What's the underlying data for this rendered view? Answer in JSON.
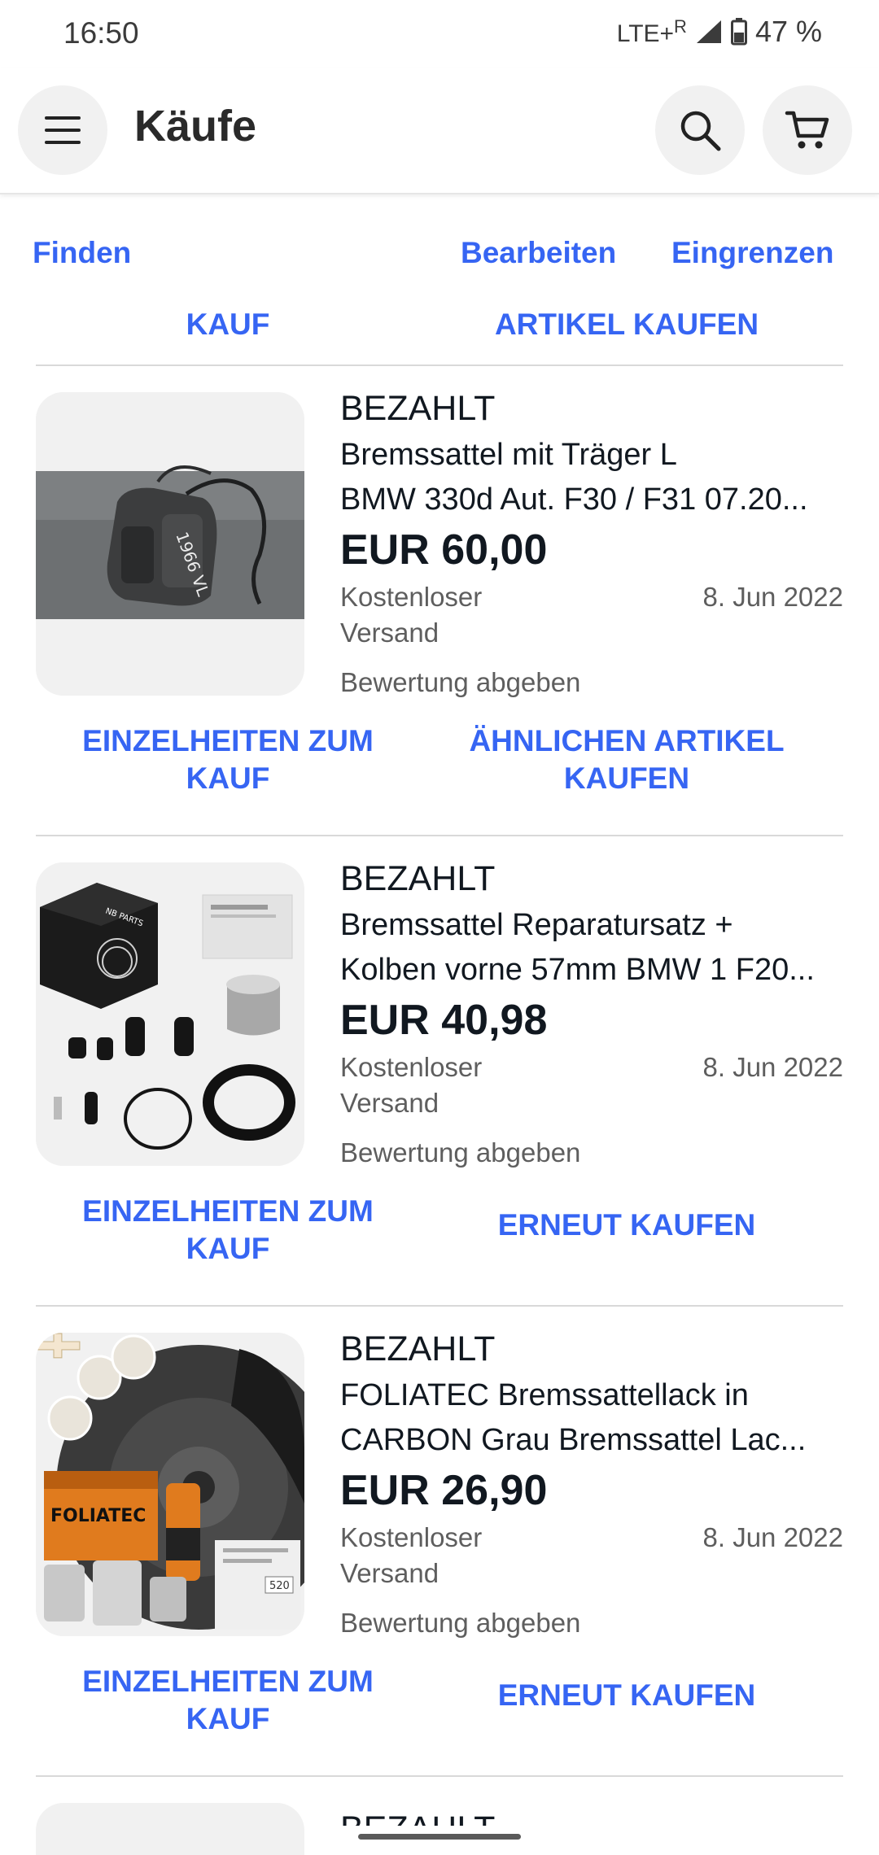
{
  "status_bar": {
    "time": "16:50",
    "network": "LTE+",
    "roaming": "R",
    "battery": "47 %"
  },
  "header": {
    "title": "Käufe"
  },
  "toolbar": {
    "find": "Finden",
    "edit": "Bearbeiten",
    "filter": "Eingrenzen"
  },
  "previous_actions": {
    "left": "KAUF",
    "right": "ARTIKEL KAUFEN"
  },
  "items": [
    {
      "status": "BEZAHLT",
      "title_line1": "Bremssattel mit Träger L",
      "title_line2": "BMW 330d Aut. F30 / F31 07.20...",
      "price": "EUR 60,00",
      "shipping": "Kostenloser Versand",
      "date": "8. Jun 2022",
      "feedback": "Bewertung abgeben",
      "action_left": "EINZELHEITEN ZUM KAUF",
      "action_right": "ÄHNLICHEN ARTIKEL KAUFEN",
      "image": "brake-caliper-photo"
    },
    {
      "status": "BEZAHLT",
      "title_line1": "Bremssattel Reparatursatz +",
      "title_line2": "Kolben vorne 57mm BMW 1 F20...",
      "price": "EUR 40,98",
      "shipping": "Kostenloser Versand",
      "date": "8. Jun 2022",
      "feedback": "Bewertung abgeben",
      "action_left": "EINZELHEITEN ZUM KAUF",
      "action_right": "ERNEUT KAUFEN",
      "image": "repair-kit-photo",
      "box_brand": "NB PARTS"
    },
    {
      "status": "BEZAHLT",
      "title_line1": "FOLIATEC Bremssattellack in",
      "title_line2": "CARBON Grau Bremssattel Lac...",
      "price": "EUR 26,90",
      "shipping": "Kostenloser Versand",
      "date": "8. Jun 2022",
      "feedback": "Bewertung abgeben",
      "action_left": "EINZELHEITEN ZUM KAUF",
      "action_right": "ERNEUT KAUFEN",
      "image": "foliatec-paint-kit-photo",
      "brand_logo": "FOLIATEC",
      "badge": "520"
    }
  ],
  "partial_item": {
    "status": "BEZAHLT"
  },
  "colors": {
    "link": "#3665f3",
    "text": "#111820",
    "secondary": "#5e5e5e",
    "chip_bg": "#f1f1f1"
  }
}
